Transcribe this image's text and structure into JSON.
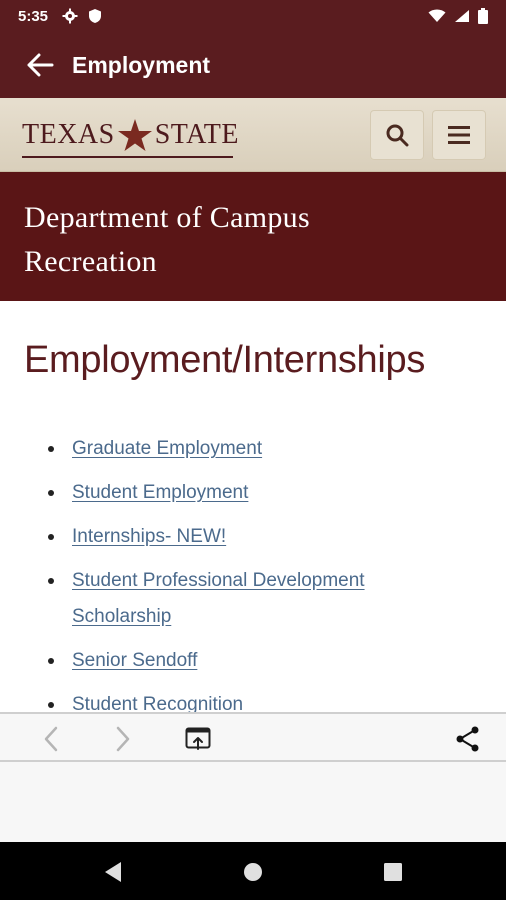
{
  "status_bar": {
    "time": "5:35"
  },
  "app_bar": {
    "title": "Employment"
  },
  "site_header": {
    "logo_left": "TEXAS",
    "logo_right": "STATE"
  },
  "banner": {
    "line1": "Department of Campus",
    "line2": "Recreation"
  },
  "content": {
    "heading": "Employment/Internships",
    "links": [
      {
        "label": "Graduate Employment"
      },
      {
        "label": "Student Employment"
      },
      {
        "label": "Internships- NEW!"
      },
      {
        "label": "Student Professional Development Scholarship"
      },
      {
        "label": "Senior Sendoff"
      },
      {
        "label": "Student Recognition"
      }
    ]
  },
  "colors": {
    "maroon": "#5a1c1f",
    "banner": "#5a1516",
    "link": "#4b6a8c",
    "header_gold": "#e7dfcf"
  },
  "icons": {
    "status": [
      "gear-icon",
      "shield-icon",
      "wifi-icon",
      "signal-icon",
      "battery-icon"
    ],
    "header": [
      "search-icon",
      "menu-icon"
    ],
    "browser": [
      "back-arrow-icon",
      "forward-arrow-icon",
      "open-in-browser-icon",
      "share-icon"
    ],
    "android": [
      "nav-back-icon",
      "nav-home-icon",
      "nav-recents-icon"
    ]
  }
}
